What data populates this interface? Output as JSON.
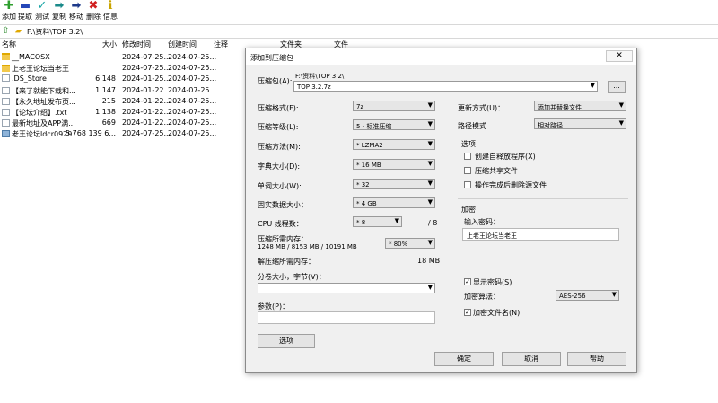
{
  "toolbar": {
    "items": [
      {
        "label": "添加",
        "icon": "add-icon",
        "glyph": "✚",
        "color": "#2e9e2e"
      },
      {
        "label": "提取",
        "icon": "extract-icon",
        "glyph": "▬",
        "color": "#2446b8"
      },
      {
        "label": "测试",
        "icon": "test-icon",
        "glyph": "✓",
        "color": "#1aa6a6"
      },
      {
        "label": "复制",
        "icon": "copy-icon",
        "glyph": "➡",
        "color": "#1a8a8a"
      },
      {
        "label": "移动",
        "icon": "move-icon",
        "glyph": "➡",
        "color": "#1d3a8a"
      },
      {
        "label": "删除",
        "icon": "delete-icon",
        "glyph": "✖",
        "color": "#d02020"
      },
      {
        "label": "信息",
        "icon": "info-icon",
        "glyph": "ℹ",
        "color": "#c9a400"
      }
    ]
  },
  "address": {
    "path": "F:\\资料\\TOP 3.2\\"
  },
  "columns": {
    "name": "名称",
    "size": "大小",
    "modified": "修改时间",
    "created": "创建时间",
    "comment": "注释",
    "folders": "文件夹",
    "files": "文件"
  },
  "files": [
    {
      "name": "__MACOSX",
      "size": "",
      "modified": "2024-07-25...",
      "created": "2024-07-25...",
      "icon": "folder"
    },
    {
      "name": "上老王论坛当老王",
      "size": "",
      "modified": "2024-07-25...",
      "created": "2024-07-25...",
      "icon": "folder"
    },
    {
      "name": ".DS_Store",
      "size": "6 148",
      "modified": "2024-01-25...",
      "created": "2024-07-25...",
      "icon": "doc"
    },
    {
      "name": "【来了就能下载和...",
      "size": "1 147",
      "modified": "2024-01-22...",
      "created": "2024-07-25...",
      "icon": "doc"
    },
    {
      "name": "【永久地址发布页...",
      "size": "215",
      "modified": "2024-01-22...",
      "created": "2024-07-25...",
      "icon": "doc"
    },
    {
      "name": "【论坛介绍】.txt",
      "size": "1 138",
      "modified": "2024-01-22...",
      "created": "2024-07-25...",
      "icon": "doc"
    },
    {
      "name": "最新地址及APP满...",
      "size": "669",
      "modified": "2024-01-22...",
      "created": "2024-07-25...",
      "icon": "doc"
    },
    {
      "name": "老王论坛ldcr0929...",
      "size": "5 768 139 6...",
      "modified": "2024-07-25...",
      "created": "2024-07-25...",
      "icon": "img"
    }
  ],
  "dialog": {
    "title": "添加到压缩包",
    "archive_label": "压缩包(A):",
    "archive_dir": "F:\\资料\\TOP 3.2\\",
    "archive_name": "TOP 3.2.7z",
    "browse": "...",
    "format_label": "压缩格式(F):",
    "format_value": "7z",
    "level_label": "压缩等级(L):",
    "level_value": "5 - 标准压缩",
    "method_label": "压缩方法(M):",
    "method_value": "* LZMA2",
    "dict_label": "字典大小(D):",
    "dict_value": "* 16 MB",
    "word_label": "单词大小(W):",
    "word_value": "* 32",
    "solid_label": "固实数据大小：",
    "solid_value": "* 4 GB",
    "cpu_label": "CPU 线程数：",
    "cpu_value": "* 8",
    "cpu_max": "/ 8",
    "mem_label": "压缩所需内存：",
    "mem_detail": "1248 MB / 8153 MB / 10191 MB",
    "mem_value": "* 80%",
    "decomp_label": "解压缩所需内存：",
    "decomp_value": "18 MB",
    "split_label": "分卷大小，字节(V)：",
    "params_label": "参数(P)：",
    "options_button": "选项",
    "update_label": "更新方式(U)：",
    "update_value": "添加并替换文件",
    "pathmode_label": "路径模式",
    "pathmode_value": "相对路径",
    "options_group": "选项",
    "opt_sfx": "创建自释放程序(X)",
    "opt_shared": "压缩共享文件",
    "opt_delete": "操作完成后删除源文件",
    "encrypt_group": "加密",
    "password_label": "输入密码：",
    "password_value": "上老王论坛当老王",
    "show_password": "显示密码(S)",
    "enc_method_label": "加密算法：",
    "enc_method_value": "AES-256",
    "encrypt_names": "加密文件名(N)",
    "ok": "确定",
    "cancel": "取消",
    "help": "帮助",
    "close_glyph": "✕"
  }
}
